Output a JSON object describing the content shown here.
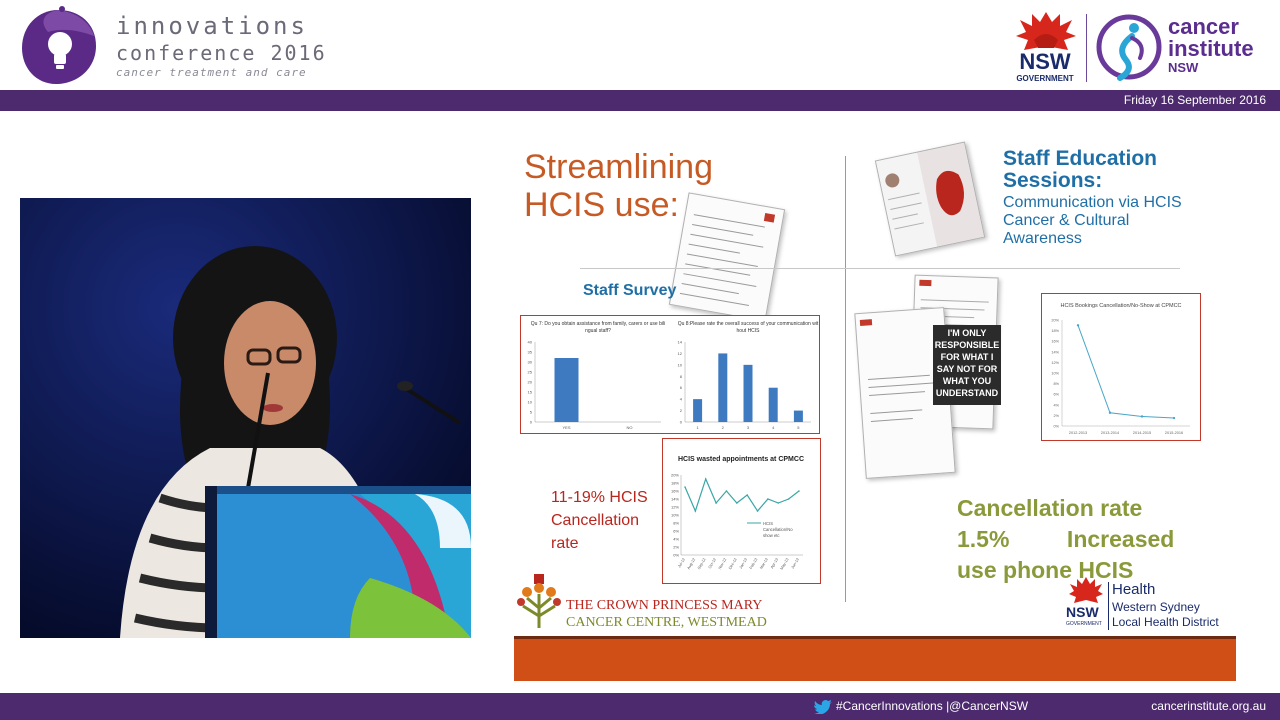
{
  "header": {
    "conference_line1": "innovations",
    "conference_line2": "conference 2016",
    "conference_sub": "cancer treatment and care",
    "nsw_logo_text": "NSW",
    "nsw_logo_sub": "GOVERNMENT",
    "ci_line1": "cancer",
    "ci_line2": "institute",
    "ci_line3": "NSW",
    "date": "Friday 16 September 2016",
    "colors": {
      "band": "#4d2a6e",
      "accent": "#5b2d8e",
      "nsw_red": "#d7261c"
    }
  },
  "slide": {
    "title_line1": "Streamlining",
    "title_line2": "HCIS use:",
    "staff_education_line1": "Staff Education",
    "staff_education_line2": "Sessions:",
    "staff_education_sub1": "Communication via HCIS",
    "staff_education_sub2": "Cancer & Cultural",
    "staff_education_sub3": "Awareness",
    "staff_survey": "Staff Survey",
    "cancellation_line1": "11-19% HCIS",
    "cancellation_line2": "Cancellation",
    "cancellation_line3": "rate",
    "result_line1": "Cancellation rate",
    "result_line2": "1.5%         Increased",
    "result_line3": "use phone HCIS",
    "stamp_text": "I'M ONLY RESPONSIBLE FOR WHAT I SAY NOT FOR WHAT YOU UNDERSTAND",
    "crown_line1": "THE CROWN PRINCESS MARY",
    "crown_line2": "CANCER CENTRE, WESTMEAD",
    "wslhd_nsw": "NSW",
    "wslhd_gov": "GOVERNMENT",
    "wslhd_health": "Health",
    "wslhd_line1": "Western Sydney",
    "wslhd_line2": "Local Health District",
    "colors": {
      "title": "#c65a25",
      "blue": "#1f6fa6",
      "red": "#b8261e",
      "olive": "#8a9a3a",
      "orange_bar": "#cf4f17"
    }
  },
  "footer": {
    "social": "#CancerInnovations  |@CancerNSW",
    "site": "cancerinstitute.org.au",
    "icon": "twitter-bird-icon"
  },
  "chart_data": [
    {
      "type": "bar",
      "title": "Qu 7: Do you obtain assistance from family, carers or use bilingual staff?",
      "categories": [
        "YES",
        "NO"
      ],
      "values": [
        32,
        0
      ],
      "ylim": [
        0,
        40
      ],
      "yticks": [
        0,
        5,
        10,
        15,
        20,
        25,
        30,
        35,
        40
      ]
    },
    {
      "type": "bar",
      "title": "Qu 8:Please rate the overall success of your communication without HCIS",
      "categories": [
        "1",
        "2",
        "3",
        "4",
        "5"
      ],
      "values": [
        4,
        12,
        10,
        6,
        2
      ],
      "ylim": [
        0,
        14
      ],
      "yticks": [
        0,
        2,
        4,
        6,
        8,
        10,
        12,
        14
      ]
    },
    {
      "type": "line",
      "title": "HCIS wasted appointments at CPMCC",
      "categories": [
        "Jul-12",
        "Aug-12",
        "Sep-12",
        "Oct-12",
        "Nov-12",
        "Dec-12",
        "Jan-13",
        "Feb-13",
        "Mar-13",
        "Apr-13",
        "May-13",
        "Jun-13"
      ],
      "series": [
        {
          "name": "HCIS Cancellation/No show etc",
          "values": [
            17,
            11,
            19,
            13,
            16,
            13,
            15,
            11,
            14,
            13,
            14,
            16
          ]
        }
      ],
      "ylim": [
        0,
        20
      ],
      "yticks": [
        "0%",
        "2%",
        "4%",
        "6%",
        "8%",
        "10%",
        "12%",
        "14%",
        "16%",
        "18%",
        "20%"
      ]
    },
    {
      "type": "line",
      "title": "HCIS Bookings Cancellation/No-Show at CPMCC",
      "categories": [
        "2012-2013",
        "2013-2014",
        "2014-2015",
        "2015-2016"
      ],
      "values": [
        19,
        2.5,
        1.8,
        1.5
      ],
      "ylim": [
        0,
        20
      ],
      "yticks": [
        "0%",
        "2%",
        "4%",
        "6%",
        "8%",
        "10%",
        "12%",
        "14%",
        "16%",
        "18%",
        "20%"
      ]
    }
  ]
}
